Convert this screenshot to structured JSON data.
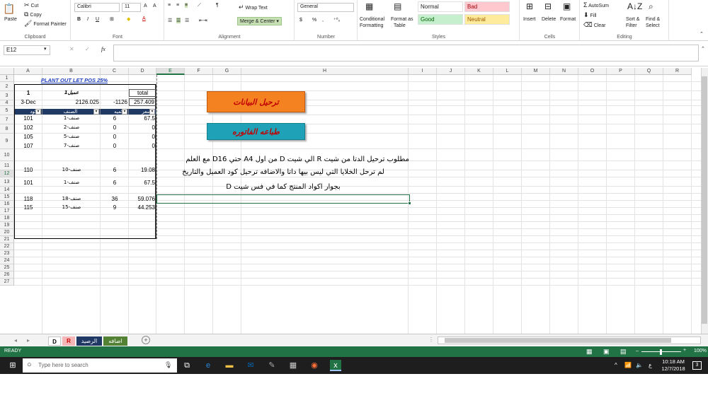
{
  "ribbon": {
    "clipboard": {
      "paste": "Paste",
      "cut": "Cut",
      "copy": "Copy",
      "format_painter": "Format Painter",
      "label": "Clipboard"
    },
    "font": {
      "name": "Calibri",
      "size": "11",
      "label": "Font",
      "bold": "B",
      "italic": "I",
      "underline": "U",
      "grow": "A",
      "shrink": "A"
    },
    "alignment": {
      "wrap_text": "Wrap Text",
      "merge_center": "Merge & Center",
      "label": "Alignment"
    },
    "number": {
      "format": "General",
      "currency": "$",
      "percent": "%",
      "comma": ",",
      "label": "Number"
    },
    "styles": {
      "conditional": "Conditional",
      "formatting": "Formatting",
      "format_as": "Format as",
      "table": "Table",
      "label": "Styles",
      "normal": "Normal",
      "bad": "Bad",
      "good": "Good",
      "neutral": "Neutral"
    },
    "cells": {
      "insert": "Insert",
      "delete": "Delete",
      "format": "Format",
      "label": "Cells"
    },
    "editing": {
      "autosum": "AutoSum",
      "fill": "Fill",
      "clear": "Clear",
      "sort_filter": "Sort &",
      "filter": "Filter",
      "find_select": "Find &",
      "select": "Select",
      "label": "Editing"
    }
  },
  "formula_bar": {
    "name_box": "E12",
    "fx": "fx",
    "value": ""
  },
  "columns": [
    "A",
    "B",
    "C",
    "D",
    "E",
    "F",
    "G",
    "H",
    "I",
    "J",
    "K",
    "L",
    "M",
    "N",
    "O",
    "P",
    "Q",
    "R"
  ],
  "rows": [
    "1",
    "2",
    "3",
    "4",
    "5",
    "7",
    "8",
    "9",
    "10",
    "11",
    "12",
    "13",
    "14",
    "15",
    "16",
    "17",
    "18",
    "19",
    "20",
    "21",
    "22",
    "23",
    "24",
    "25",
    "26",
    "27"
  ],
  "sheet": {
    "title": "PLANT OUT LET POS 25%",
    "a2": "1",
    "b2": "عميل1",
    "d2": "total",
    "a3": "3-Dec",
    "b3": "2126.025",
    "c3": "-1126",
    "d3": "257.409",
    "headers": [
      "الكود",
      "الصنف",
      "الكميه",
      "السعر"
    ],
    "data": [
      {
        "code": "101",
        "item": "صنف-1",
        "qty": "6",
        "price": "67.5"
      },
      {
        "code": "102",
        "item": "صنف-2",
        "qty": "0",
        "price": "0"
      },
      {
        "code": "105",
        "item": "صنف-5",
        "qty": "0",
        "price": "0"
      },
      {
        "code": "107",
        "item": "صنف-7",
        "qty": "0",
        "price": "0"
      },
      {
        "code": "110",
        "item": "صنف-10",
        "qty": "6",
        "price": "19.08"
      },
      {
        "code": "101",
        "item": "صنف-1",
        "qty": "6",
        "price": "67.5"
      },
      {
        "code": "118",
        "item": "صنف-18",
        "qty": "36",
        "price": "59.076"
      },
      {
        "code": "115",
        "item": "صنف-15",
        "qty": "9",
        "price": "44.253"
      }
    ],
    "button_transfer": "ترحيل البيانات",
    "button_print": "طباعه الفاتوره",
    "note_line1": "مطلوب ترحيل الدتا من شيت R الي شيت D  من اول A4 حتي D16 مع العلم",
    "note_line2": "لم ترحل الخلايا التي ليس بيها داتا والاضافه ترحيل كود العميل والتاريخ",
    "note_line3": "بجوار اكواد المنتج كما في فس شيت D"
  },
  "sheet_tabs": [
    "D",
    "R",
    "الرصيد",
    "اضافه"
  ],
  "status": {
    "ready": "READY",
    "zoom": "100%"
  },
  "taskbar": {
    "search": "Type here to search",
    "time": "10:18 AM",
    "date": "12/7/2018",
    "lang": "ع",
    "notif": "3"
  },
  "colors": {
    "excel_green": "#217346",
    "header_navy": "#1f3864",
    "btn_orange": "#f58220",
    "btn_teal": "#1fa2b8",
    "bad_bg": "#ffc7ce",
    "good_bg": "#c6efce",
    "neutral_bg": "#ffeb9c"
  }
}
